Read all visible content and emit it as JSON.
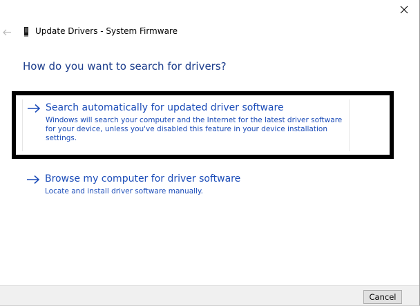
{
  "window": {
    "title": "Update Drivers - System Firmware"
  },
  "content": {
    "heading": "How do you want to search for drivers?",
    "options": [
      {
        "title": "Search automatically for updated driver software",
        "description": "Windows will search your computer and the Internet for the latest driver software for your device, unless you've disabled this feature in your device installation settings."
      },
      {
        "title": "Browse my computer for driver software",
        "description": "Locate and install driver software manually."
      }
    ]
  },
  "footer": {
    "cancel_label": "Cancel"
  },
  "icons": {
    "close": "close-icon",
    "back": "back-arrow-icon",
    "device": "device-icon",
    "option_arrow": "arrow-right-icon"
  },
  "colors": {
    "heading": "#1c3d8c",
    "link": "#1b4cb8",
    "highlight_border": "#000000",
    "footer_bg": "#f0f0f0"
  }
}
